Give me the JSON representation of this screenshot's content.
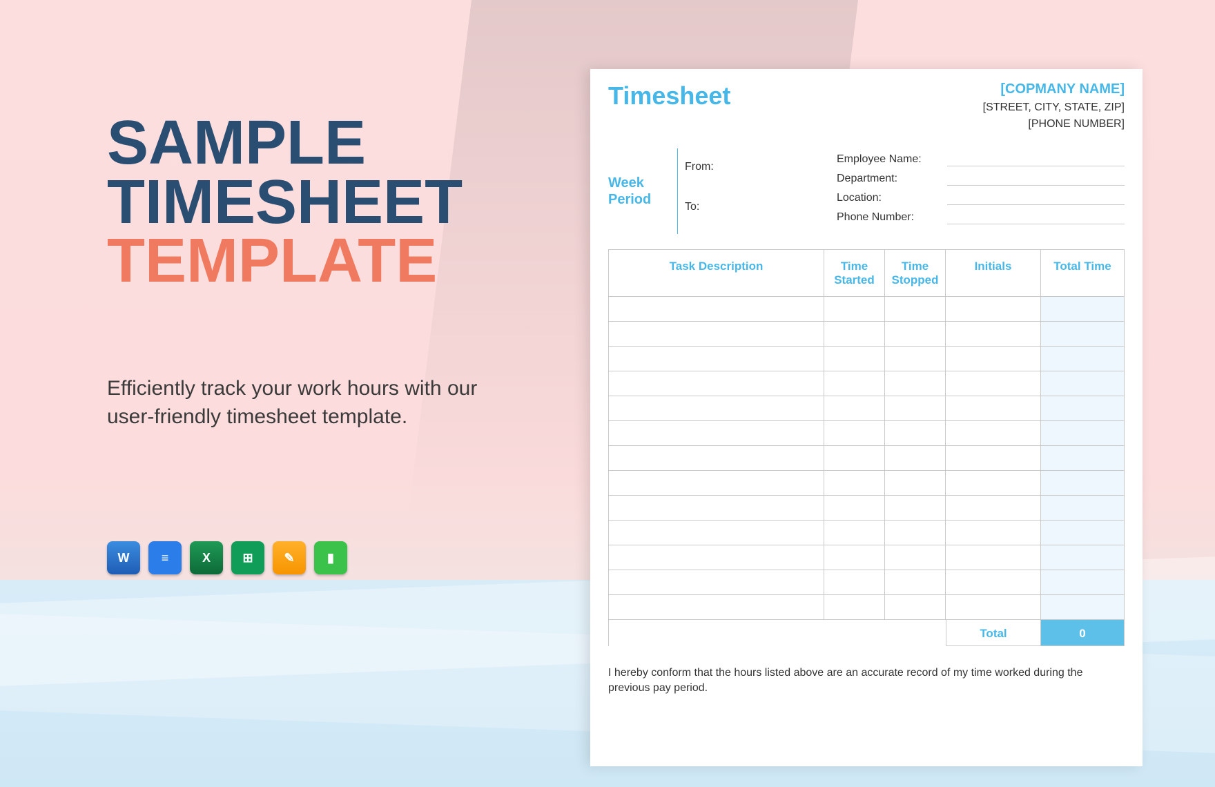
{
  "left": {
    "title_line1": "SAMPLE",
    "title_line2": "TIMESHEET",
    "title_line3": "TEMPLATE",
    "subtitle": "Efficiently track your work hours with our user-friendly timesheet template."
  },
  "icons": {
    "word": {
      "name": "microsoft-word-icon",
      "glyph": "W"
    },
    "docs": {
      "name": "google-docs-icon",
      "glyph": "≡"
    },
    "excel": {
      "name": "microsoft-excel-icon",
      "glyph": "X"
    },
    "sheets": {
      "name": "google-sheets-icon",
      "glyph": "⊞"
    },
    "pages": {
      "name": "apple-pages-icon",
      "glyph": "✎"
    },
    "numbers": {
      "name": "apple-numbers-icon",
      "glyph": "▮"
    }
  },
  "doc": {
    "title": "Timesheet",
    "company_name": "[COPMANY NAME]",
    "company_address": "[STREET, CITY, STATE, ZIP]",
    "company_phone": "[PHONE NUMBER]",
    "week_label": "Week Period",
    "from_label": "From:",
    "to_label": "To:",
    "employee_fields": [
      "Employee Name:",
      "Department:",
      "Location:",
      "Phone Number:"
    ],
    "columns": {
      "task": "Task Description",
      "time_started": "Time Started",
      "time_stopped": "Time Stopped",
      "initials": "Initials",
      "total_time": "Total Time"
    },
    "row_count": 13,
    "footer": {
      "total_label": "Total",
      "total_value": "0"
    },
    "disclaimer": "I hereby conform that the hours listed above are an accurate record of my time worked during the previous pay period."
  },
  "colors": {
    "brand_blue": "#47b7e8",
    "dark_blue": "#2a4d72",
    "accent_coral": "#f07a5f",
    "cell_blue": "#5cc0e8"
  }
}
